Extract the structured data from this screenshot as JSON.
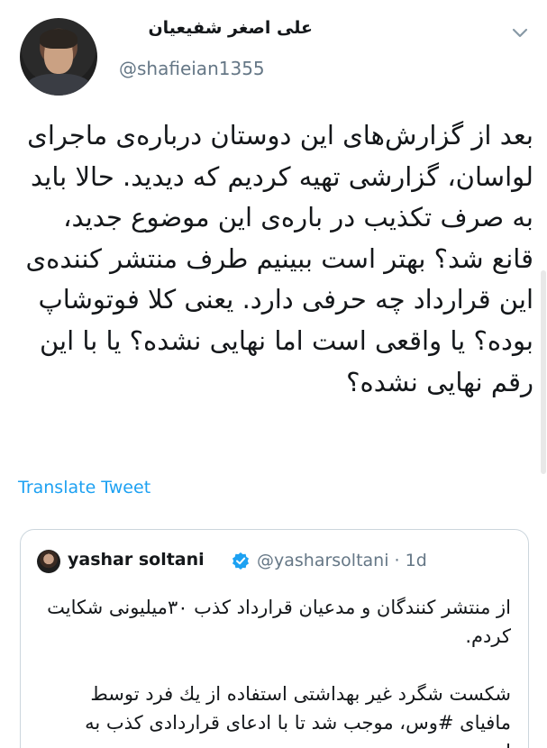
{
  "tweet": {
    "author_name": "علی اصغر شفیعیان",
    "author_handle": "@shafieian1355",
    "text": "بعد از گزارش‌های این دوستان درباره‌ی ماجرای لواسان، گزارشی تهیه کردیم که دیدید. حالا باید به صرف تکذیب در باره‌ی این موضوع جدید، قانع شد؟ بهتر است ببینیم طرف منتشر کننده‌ی این قرارداد چه حرفی دارد. یعنی کلا فوتوشاپ بوده؟ یا واقعی است اما نهایی نشده؟ یا با این رقم نهایی نشده؟",
    "translate_label": "Translate Tweet"
  },
  "quoted_tweet": {
    "author_name": "yashar soltani",
    "author_handle": "@yasharsoltani · 1d",
    "text_paragraph_1": "از منتشر کنندگان و مدعیان قرارداد کذب ۳۰میلیونی شکایت کردم.",
    "text_paragraph_2": "شکست شگرد غیر بهداشتی استفاده از یك فرد توسط مافیای #وس، موجب شد تا با ادعای قراردادی کذب به اس..."
  },
  "icons": {
    "menu": "chevron-down-icon",
    "verified": "verified-badge-icon"
  },
  "colors": {
    "link": "#1da1f2",
    "secondary_text": "#657786",
    "border": "#ccd6dd"
  }
}
